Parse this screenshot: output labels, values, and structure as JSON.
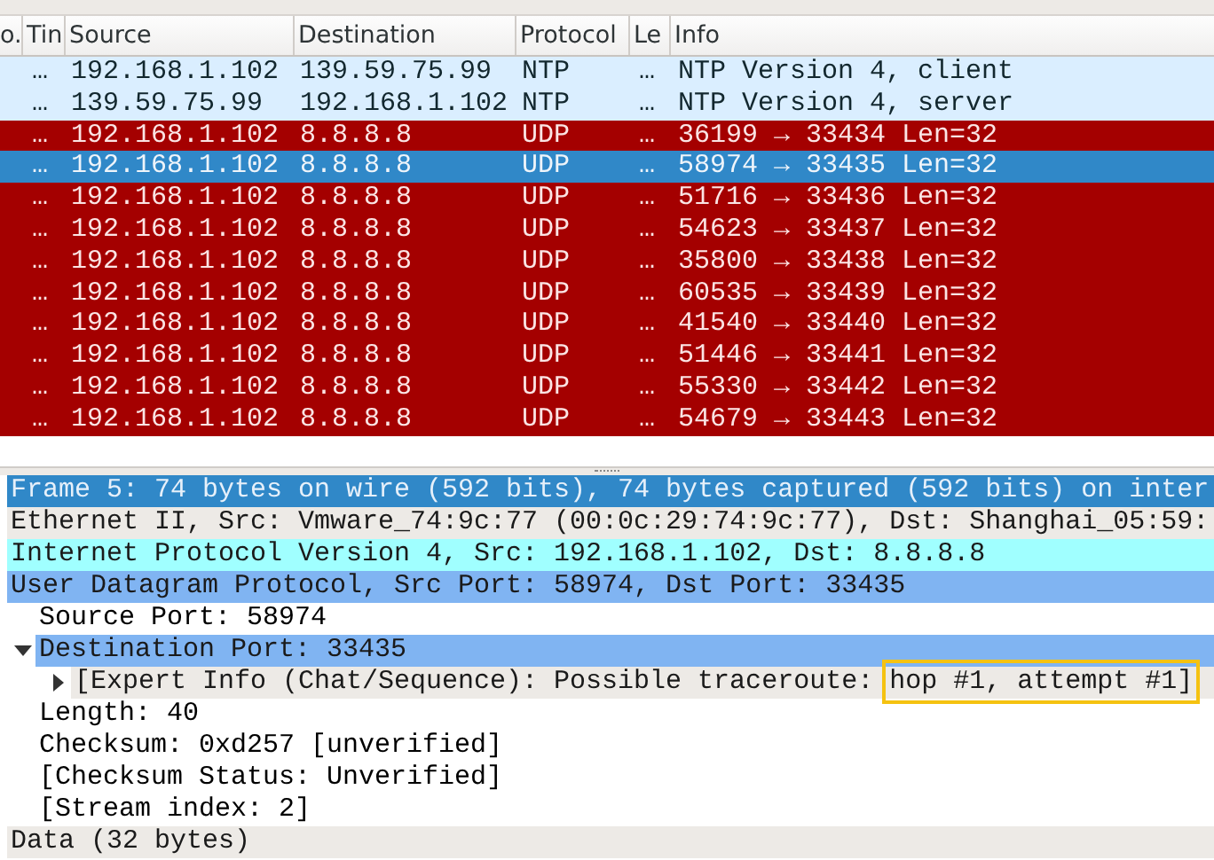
{
  "packet_list": {
    "columns": [
      "o.",
      "Tin",
      "Source",
      "Destination",
      "Protocol",
      "Le",
      "Info"
    ],
    "rows": [
      {
        "time": "…",
        "source": "192.168.1.102",
        "destination": "139.59.75.99",
        "protocol": "NTP",
        "length": "…",
        "info": "NTP Version 4, client",
        "kind": "ntp",
        "selected": false
      },
      {
        "time": "…",
        "source": "139.59.75.99",
        "destination": "192.168.1.102",
        "protocol": "NTP",
        "length": "…",
        "info": "NTP Version 4, server",
        "kind": "ntp",
        "selected": false
      },
      {
        "time": "…",
        "source": "192.168.1.102",
        "destination": "8.8.8.8",
        "protocol": "UDP",
        "length": "…",
        "info": "36199 → 33434 Len=32",
        "kind": "udp",
        "selected": false
      },
      {
        "time": "…",
        "source": "192.168.1.102",
        "destination": "8.8.8.8",
        "protocol": "UDP",
        "length": "…",
        "info": "58974 → 33435 Len=32",
        "selected": true
      },
      {
        "time": "…",
        "source": "192.168.1.102",
        "destination": "8.8.8.8",
        "protocol": "UDP",
        "length": "…",
        "info": "51716 → 33436 Len=32",
        "kind": "udp",
        "selected": false
      },
      {
        "time": "…",
        "source": "192.168.1.102",
        "destination": "8.8.8.8",
        "protocol": "UDP",
        "length": "…",
        "info": "54623 → 33437 Len=32",
        "kind": "udp",
        "selected": false
      },
      {
        "time": "…",
        "source": "192.168.1.102",
        "destination": "8.8.8.8",
        "protocol": "UDP",
        "length": "…",
        "info": "35800 → 33438 Len=32",
        "kind": "udp",
        "selected": false
      },
      {
        "time": "…",
        "source": "192.168.1.102",
        "destination": "8.8.8.8",
        "protocol": "UDP",
        "length": "…",
        "info": "60535 → 33439 Len=32",
        "kind": "udp",
        "selected": false
      },
      {
        "time": "…",
        "source": "192.168.1.102",
        "destination": "8.8.8.8",
        "protocol": "UDP",
        "length": "…",
        "info": "41540 → 33440 Len=32",
        "kind": "udp",
        "selected": false
      },
      {
        "time": "…",
        "source": "192.168.1.102",
        "destination": "8.8.8.8",
        "protocol": "UDP",
        "length": "…",
        "info": "51446 → 33441 Len=32",
        "kind": "udp",
        "selected": false
      },
      {
        "time": "…",
        "source": "192.168.1.102",
        "destination": "8.8.8.8",
        "protocol": "UDP",
        "length": "…",
        "info": "55330 → 33442 Len=32",
        "kind": "udp",
        "selected": false
      },
      {
        "time": "…",
        "source": "192.168.1.102",
        "destination": "8.8.8.8",
        "protocol": "UDP",
        "length": "…",
        "info": "54679 → 33443 Len=32",
        "kind": "udp",
        "selected": false
      }
    ]
  },
  "packet_details": [
    {
      "text": "Frame 5: 74 bytes on wire (592 bits), 74 bytes captured (592 bits) on inter",
      "color": "#3088c8"
    },
    {
      "text": "Ethernet II, Src: Vmware_74:9c:77 (00:0c:29:74:9c:77), Dst: Shanghai_05:59:",
      "color": "#edeae6"
    },
    {
      "text": "Internet Protocol Version 4, Src: 192.168.1.102, Dst: 8.8.8.8",
      "color": "#a0ffff"
    },
    {
      "text": "User Datagram Protocol, Src Port: 58974, Dst Port: 33435",
      "color": "#80b4f2",
      "children": [
        {
          "text": "Source Port: 58974"
        },
        {
          "text": "Destination Port: 33435",
          "color": "#80b4f2",
          "expanded": true,
          "children": [
            {
              "text": "[Expert Info (Chat/Sequence): Possible traceroute: ",
              "highlight": "hop #1, attempt #1]",
              "color": "#edeae6",
              "expanded": false
            }
          ]
        },
        {
          "text": "Length: 40"
        },
        {
          "text": "Checksum: 0xd257 [unverified]"
        },
        {
          "text": "[Checksum Status: Unverified]"
        },
        {
          "text": "[Stream index: 2]"
        }
      ]
    },
    {
      "text": "Data (32 bytes)",
      "color": "#edeae6"
    }
  ]
}
